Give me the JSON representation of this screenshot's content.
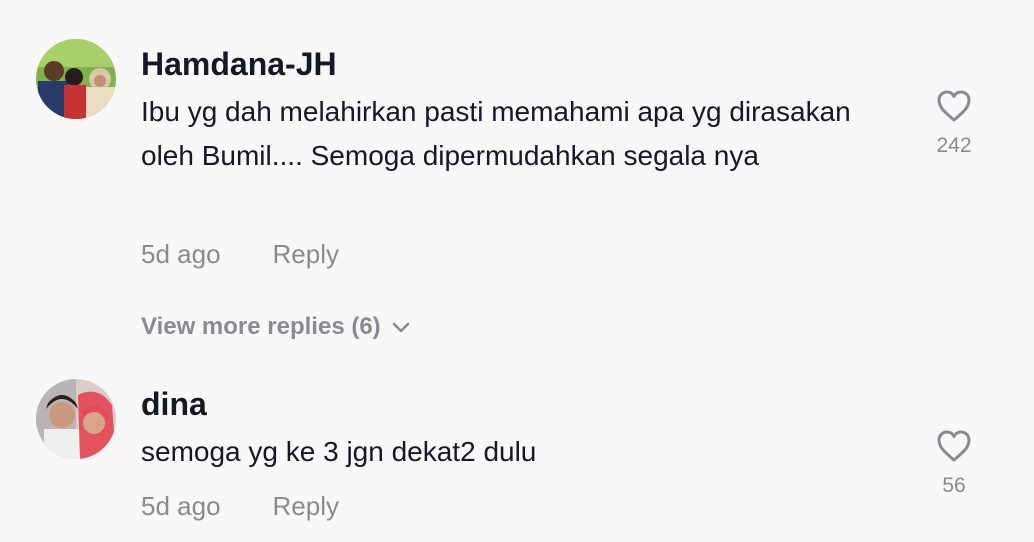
{
  "comments": [
    {
      "username": "Hamdana-JH",
      "text": "Ibu yg dah melahirkan pasti memahami apa yg dirasakan oleh Bumil.... Semoga dipermudahkan segala nya",
      "time": "5d ago",
      "reply_label": "Reply",
      "likes": "242"
    },
    {
      "username": "dina",
      "text": "semoga yg ke 3 jgn dekat2 dulu",
      "time": "5d ago",
      "reply_label": "Reply",
      "likes": "56"
    }
  ],
  "view_more": {
    "label": "View more replies (6)"
  },
  "icons": {
    "like": "heart-outline-icon",
    "expand": "chevron-down-icon"
  },
  "colors": {
    "background": "#f8f8f8",
    "primary_text": "#161823",
    "secondary_text": "#8a8b91"
  }
}
